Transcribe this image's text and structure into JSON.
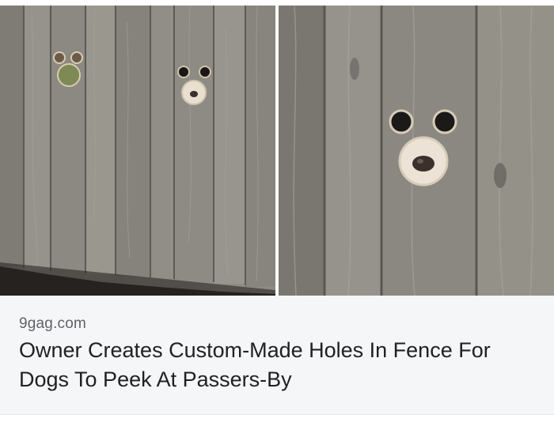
{
  "article": {
    "source": "9gag.com",
    "headline": "Owner Creates Custom-Made Holes In Fence For Dogs To Peek At Passers-By"
  },
  "colors": {
    "caption_background": "#f5f6f8",
    "source_text": "#5f6368",
    "headline_text": "#202124",
    "fence_wood": "#8a8780"
  }
}
